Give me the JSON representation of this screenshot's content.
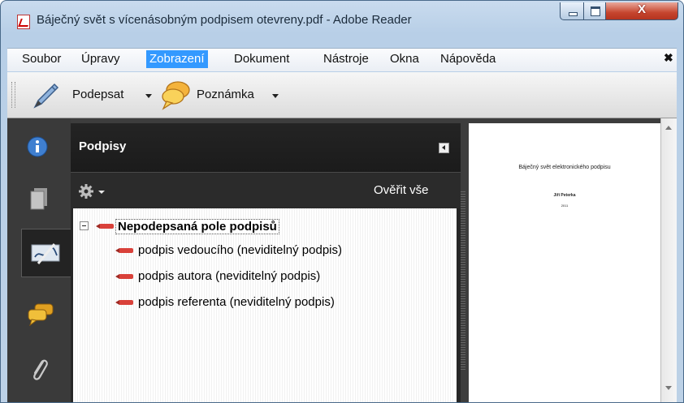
{
  "window": {
    "title": "Báječný svět s vícenásobným podpisem otevreny.pdf - Adobe Reader",
    "app_icon": "adobe-pdf-icon",
    "controls": [
      "minimize",
      "maximize",
      "close"
    ],
    "close_glyph": "X"
  },
  "menubar": {
    "items": [
      "Soubor",
      "Úpravy",
      "Zobrazení",
      "Dokument",
      "Nástroje",
      "Okna",
      "Nápověda"
    ],
    "active": "Zobrazení",
    "close_glyph": "✖"
  },
  "toolbar": {
    "sign_label": "Podepsat",
    "sign_icon": "pen-icon",
    "note_label": "Poznámka",
    "note_icon": "comment-bubble-icon"
  },
  "nav_panel": {
    "buttons": [
      "info-icon",
      "pages-icon",
      "signatures-icon",
      "comments-icon",
      "attachments-icon"
    ],
    "active": "signatures-icon"
  },
  "signatures_panel": {
    "title": "Podpisy",
    "options_icon": "gear-icon",
    "verify_all_label": "Ověřit vše",
    "tree": {
      "root_label": "Nepodepsaná pole podpisů",
      "items": [
        "podpis vedoucího (neviditelný podpis)",
        "podpis autora (neviditelný podpis)",
        "podpis referenta (neviditelný podpis)"
      ]
    }
  },
  "document_page": {
    "title": "Báječný svět elektronického podpisu",
    "author": "Jiří Peterka",
    "year": "2011"
  },
  "colors": {
    "menu_highlight": "#3399ff",
    "panel_dark": "#262626",
    "close_button": "#c6452e",
    "pen_red": "#d9413a"
  }
}
